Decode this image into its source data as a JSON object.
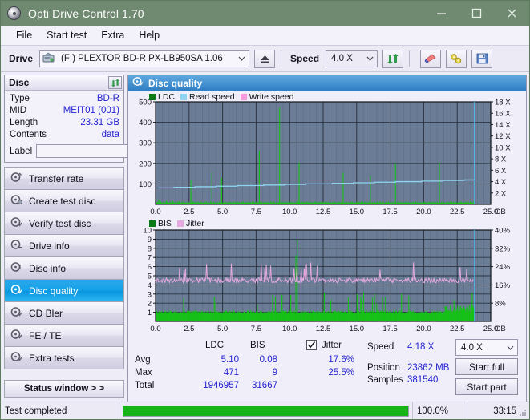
{
  "window": {
    "title": "Opti Drive Control 1.70",
    "icon": "disc-icon",
    "minimize": "minimize-icon",
    "maximize": "maximize-icon",
    "close": "close-icon"
  },
  "menu": {
    "items": [
      "File",
      "Start test",
      "Extra",
      "Help"
    ]
  },
  "toolbar": {
    "drive_label": "Drive",
    "drive_value": "(F:)   PLEXTOR BD-R  PX-LB950SA 1.06",
    "eject_icon": "eject-icon",
    "speed_label": "Speed",
    "speed_value": "4.0 X",
    "refresh_icon": "refresh-icon",
    "erase_icon": "eraser-icon",
    "tools_icon": "tools-icon",
    "save_icon": "save-icon"
  },
  "disc": {
    "header": "Disc",
    "refresh_icon": "refresh-icon",
    "rows": [
      {
        "key": "Type",
        "value": "BD-R"
      },
      {
        "key": "MID",
        "value": "MEIT01 (001)"
      },
      {
        "key": "Length",
        "value": "23.31 GB"
      },
      {
        "key": "Contents",
        "value": "data"
      }
    ],
    "label_key": "Label",
    "label_value": "",
    "label_placeholder": "",
    "disc_button_icon": "disc-icon"
  },
  "nav": {
    "items": [
      {
        "label": "Transfer rate",
        "icon": "disc-test-icon",
        "active": false
      },
      {
        "label": "Create test disc",
        "icon": "disc-burn-icon",
        "active": false
      },
      {
        "label": "Verify test disc",
        "icon": "disc-verify-icon",
        "active": false
      },
      {
        "label": "Drive info",
        "icon": "disc-info-icon",
        "active": false
      },
      {
        "label": "Disc info",
        "icon": "disc-info-icon",
        "active": false
      },
      {
        "label": "Disc quality",
        "icon": "disc-quality-icon",
        "active": true
      },
      {
        "label": "CD Bler",
        "icon": "disc-bler-icon",
        "active": false
      },
      {
        "label": "FE / TE",
        "icon": "disc-fete-icon",
        "active": false
      },
      {
        "label": "Extra tests",
        "icon": "disc-extra-icon",
        "active": false
      }
    ],
    "status_window": "Status window > >"
  },
  "panel": {
    "title": "Disc quality",
    "icon": "disc-quality-icon"
  },
  "chart_data": [
    {
      "type": "line",
      "name": "ldc-chart",
      "title": "",
      "xlabel": "GB",
      "ylabel": "",
      "xlim": [
        0.0,
        25.0
      ],
      "xticks": [
        "0.0",
        "2.5",
        "5.0",
        "7.5",
        "10.0",
        "12.5",
        "15.0",
        "17.5",
        "20.0",
        "22.5",
        "25.0"
      ],
      "xunit": "GB",
      "ylim": [
        0,
        500
      ],
      "yticks": [
        "100",
        "200",
        "300",
        "400",
        "500"
      ],
      "y2lim": [
        0,
        18
      ],
      "y2ticks": [
        "2 X",
        "4 X",
        "6 X",
        "8 X",
        "10 X",
        "12 X",
        "14 X",
        "16 X",
        "18 X"
      ],
      "grid": true,
      "legend": [
        {
          "label": "LDC",
          "color": "#0a7a14"
        },
        {
          "label": "Read speed",
          "color": "#8ed4f2"
        },
        {
          "label": "Write speed",
          "color": "#f49ad8"
        }
      ],
      "series": [
        {
          "name": "LDC",
          "color": "#14c314",
          "type": "bar",
          "values": [
            18,
            9,
            12,
            7,
            22,
            10,
            8,
            15,
            9,
            6,
            11,
            8,
            14,
            7,
            9,
            20,
            12,
            8,
            6,
            10,
            9,
            14,
            8,
            7,
            19,
            11,
            9,
            6,
            13,
            8,
            7,
            12,
            9,
            16,
            8,
            6,
            11,
            9,
            7,
            14,
            8,
            10,
            7,
            9,
            12,
            8,
            6,
            11,
            9,
            7,
            120,
            9,
            8,
            15,
            10,
            7,
            12,
            9,
            6,
            14,
            8,
            11,
            7,
            9,
            13,
            8,
            6,
            10,
            9,
            7,
            12,
            8,
            14,
            9,
            6,
            11,
            8,
            7,
            13,
            9,
            155,
            10,
            7,
            12,
            9,
            6,
            14,
            8,
            11,
            7,
            9,
            13,
            8,
            6,
            130,
            9,
            7,
            12,
            8,
            14,
            9,
            6,
            11,
            8,
            7,
            13,
            9,
            10,
            7,
            12,
            9,
            6,
            14,
            8,
            11,
            7,
            9,
            13,
            8,
            6,
            10,
            9,
            7,
            12,
            8,
            14,
            9,
            6,
            11,
            8,
            7,
            13,
            9,
            10,
            7,
            12,
            9,
            6,
            14,
            8,
            11,
            7,
            9,
            13,
            8,
            6,
            10,
            9,
            260,
            12,
            8,
            14,
            9,
            6,
            11,
            8,
            7,
            13,
            9,
            10,
            7,
            12,
            9,
            6,
            14,
            8,
            11,
            7,
            9,
            13,
            8,
            6,
            10,
            9,
            7,
            12,
            8,
            471,
            9,
            6,
            11,
            8,
            7,
            13,
            9,
            10,
            7,
            12,
            9,
            6,
            14,
            8,
            11,
            7,
            9,
            13,
            8,
            6,
            10,
            9,
            7,
            12,
            8,
            14,
            9,
            205,
            11,
            8,
            7,
            13,
            9,
            10,
            7,
            12,
            9,
            6,
            14,
            8,
            11,
            7,
            9,
            13,
            8,
            6,
            10,
            9,
            7,
            12,
            8,
            14,
            9,
            6,
            11,
            8,
            7,
            13,
            9,
            10,
            7,
            12,
            9,
            6,
            14,
            8,
            11,
            7,
            9,
            13,
            8,
            6,
            10,
            9,
            7,
            12,
            8,
            14,
            9,
            6,
            11,
            8,
            7,
            13,
            9,
            10,
            7,
            12,
            9,
            6,
            155,
            8,
            11,
            7,
            9,
            13,
            8,
            6,
            10,
            9,
            7,
            12,
            8,
            14,
            9,
            6,
            11,
            8,
            7,
            13,
            9,
            10,
            7,
            12,
            9,
            6,
            14,
            8,
            11,
            7,
            9,
            13,
            8,
            6,
            10,
            9,
            7,
            12,
            8,
            140,
            9,
            6,
            11,
            8,
            7,
            13,
            9,
            10,
            7,
            12,
            9,
            6,
            14,
            8,
            11,
            7,
            9,
            13,
            8,
            6,
            10,
            9,
            7,
            12,
            8,
            14,
            9,
            6,
            11,
            8,
            7,
            13,
            9,
            10,
            7,
            200,
            9,
            6,
            14,
            8,
            11,
            7,
            9,
            13,
            8,
            6,
            10,
            9,
            7,
            12,
            8,
            14,
            9,
            6,
            11,
            8,
            7,
            13,
            9,
            10,
            7,
            12,
            9,
            6,
            14,
            8,
            11,
            7,
            9,
            13,
            8,
            6,
            10,
            9,
            7,
            12,
            8,
            14,
            9,
            6,
            11,
            8,
            7,
            13,
            9,
            10,
            7,
            12,
            9,
            6,
            14,
            8,
            11,
            7,
            9,
            13,
            8,
            6,
            205,
            9,
            7,
            12,
            8,
            14,
            9,
            6,
            11,
            8,
            7,
            13,
            9,
            10,
            7,
            12,
            9,
            6,
            14,
            8,
            11,
            7,
            9,
            13,
            8,
            6,
            10,
            9,
            7,
            12,
            8,
            14,
            9,
            6,
            11,
            8,
            7,
            13,
            9,
            10,
            7,
            12,
            9,
            6,
            14,
            8,
            11,
            7,
            9,
            13,
            8,
            6,
            10,
            9,
            7,
            12,
            8,
            14,
            9,
            6,
            11,
            8,
            7,
            13,
            9,
            10,
            7,
            12,
            9,
            6,
            14,
            8,
            11,
            7
          ]
        },
        {
          "name": "Read speed",
          "color": "#8ed4f2",
          "type": "line",
          "start_x": 0.2,
          "end_x": 23.8,
          "start_speed": 2.9,
          "end_speed": 4.3,
          "final_rise_speed": 17.6
        }
      ]
    },
    {
      "type": "line",
      "name": "bis-jitter-chart",
      "title": "",
      "xlabel": "GB",
      "xlim": [
        0.0,
        25.0
      ],
      "xticks": [
        "0.0",
        "2.5",
        "5.0",
        "7.5",
        "10.0",
        "12.5",
        "15.0",
        "17.5",
        "20.0",
        "22.5",
        "25.0"
      ],
      "xunit": "GB",
      "ylim": [
        0,
        10
      ],
      "yticks": [
        "1",
        "2",
        "3",
        "4",
        "5",
        "6",
        "7",
        "8",
        "9",
        "10"
      ],
      "y2lim": [
        0,
        40
      ],
      "y2ticks": [
        "8%",
        "16%",
        "24%",
        "32%",
        "40%"
      ],
      "grid": true,
      "legend": [
        {
          "label": "BIS",
          "color": "#0a7a14"
        },
        {
          "label": "Jitter",
          "color": "#e3a9dd"
        }
      ],
      "series": [
        {
          "name": "BIS",
          "color": "#14c314",
          "type": "bar",
          "baseline": 0.85,
          "spike_max": 9
        },
        {
          "name": "Jitter",
          "color": "#e3a9dd",
          "type": "line",
          "mean_percent": 17.6,
          "max_percent": 25.5
        }
      ]
    }
  ],
  "stats": {
    "columns": [
      "LDC",
      "BIS"
    ],
    "jitter_label": "Jitter",
    "jitter_checked": true,
    "rows": [
      {
        "key": "Avg",
        "ldc": "5.10",
        "bis": "0.08",
        "jitter": "17.6%"
      },
      {
        "key": "Max",
        "ldc": "471",
        "bis": "9",
        "jitter": "25.5%"
      },
      {
        "key": "Total",
        "ldc": "1946957",
        "bis": "31667",
        "jitter": ""
      }
    ]
  },
  "results": {
    "speed_key": "Speed",
    "speed_value": "4.18 X",
    "position_key": "Position",
    "position_value": "23862 MB",
    "samples_key": "Samples",
    "samples_value": "381540",
    "speed_select": "4.0 X",
    "start_full": "Start full",
    "start_part": "Start part"
  },
  "statusbar": {
    "message": "Test completed",
    "progress_percent": "100.0%",
    "progress_value": 100,
    "elapsed": "33:15"
  },
  "colors": {
    "title_bar": "#6f8a70",
    "accent": "#2323cf",
    "ldc_green": "#14c314",
    "read_speed": "#8ed4f2",
    "write_speed": "#f49ad8",
    "jitter": "#e3a9dd",
    "plot_bg": "#6b7d96",
    "active_nav": "#16a2ea",
    "progress": "#16b416"
  }
}
